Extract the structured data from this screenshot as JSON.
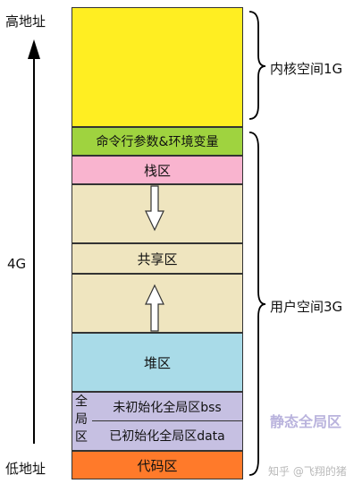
{
  "labels": {
    "high_address": "高地址",
    "low_address": "低地址",
    "total_size": "4G",
    "kernel_space": "内核空间1G",
    "user_space": "用户空间3G",
    "static_global": "静态全局区"
  },
  "segments": {
    "kernel": "",
    "cmdline_env": "命令行参数&环境变量",
    "stack": "栈区",
    "shared": "共享区",
    "heap": "堆区",
    "global_side": "全局区",
    "bss": "未初始化全局区bss",
    "data": "已初始化全局区data",
    "code": "代码区"
  },
  "colors": {
    "kernel": "#ffee22",
    "cmdline_env": "#9fd33f",
    "stack": "#f9b4cf",
    "beige": "#efe5bf",
    "heap": "#a9dbe8",
    "global": "#c6c0e2",
    "code": "#ff7a2a",
    "static_label": "#b9b3dd"
  },
  "watermark": "知乎 @飞翔的猪"
}
